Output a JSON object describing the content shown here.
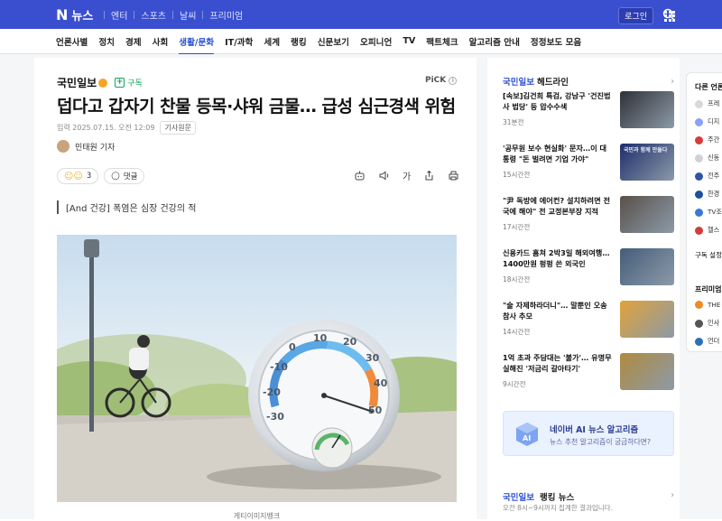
{
  "topbar": {
    "logo_n": "N",
    "logo_text": "뉴스",
    "links": [
      "엔터",
      "스포츠",
      "날씨",
      "프리미엄"
    ],
    "login": "로그인"
  },
  "nav": [
    "언론사별",
    "정치",
    "경제",
    "사회",
    "생활/문화",
    "IT/과학",
    "세계",
    "랭킹",
    "신문보기",
    "오피니언",
    "TV",
    "팩트체크",
    "알고리즘 안내",
    "정정보도 모음"
  ],
  "nav_active": "생활/문화",
  "article": {
    "press": "국민일보",
    "subscribe": "구독",
    "pick": "PiCK",
    "headline": "덥다고 갑자기 찬물 등목·샤워 금물… 급성 심근경색 위험",
    "date": "입력 2025.07.15. 오전 12:09",
    "original": "기사원문",
    "reporter": "민태원 기자",
    "reaction_count": "3",
    "comment_label": "댓글",
    "subtitle": "[And 건강] 폭염은 심장 건강의 적",
    "caption": "게티이미지뱅크",
    "thermo_scale": [
      "-30",
      "-20",
      "-10",
      "0",
      "10",
      "20",
      "30",
      "40",
      "50"
    ]
  },
  "right": {
    "press": "국민일보",
    "header": "헤드라인",
    "items": [
      {
        "title": "[속보]김건희 특검, 강남구 '건진법사 법당' 등 압수수색",
        "time": "31분전"
      },
      {
        "title": "'공무원 보수 현실화' 문자…이 대통령 \"돈 벌려면 기업 가야\"",
        "time": "15시간전"
      },
      {
        "title": "\"尹 독방에 에어컨? 설치하려면 전국에 해야\" 전 교정본부장 지적",
        "time": "17시간전"
      },
      {
        "title": "신용카드 훔쳐 2박3일 해외여행…1400만원 펑펑 쓴 외국인",
        "time": "18시간전"
      },
      {
        "title": "\"술 자제하라더니\"… 말뿐인 오송 참사 추모",
        "time": "14시간전"
      },
      {
        "title": "1억 초과 주담대는 '불가'… 유명무실해진 '저금리 갈아타기'",
        "time": "9시간전"
      }
    ],
    "thumb2_text": "국민과 함께 만들다",
    "ai_title": "네이버 AI 뉴스 알고리즘",
    "ai_sub": "뉴스 추천 알고리즘이 궁금하다면?",
    "rank_press": "국민일보",
    "rank_header": "랭킹 뉴스",
    "rank_sub": "오전 8시~9시까지 집계한 결과입니다."
  },
  "farright": {
    "title1": "다른 언론사",
    "list1": [
      "프레",
      "디지",
      "주간",
      "신동",
      "전주",
      "한경",
      "TV조",
      "헬스"
    ],
    "manage": "구독 설정",
    "title2": "프리미엄",
    "list2": [
      "THE",
      "인사",
      "언더"
    ]
  }
}
